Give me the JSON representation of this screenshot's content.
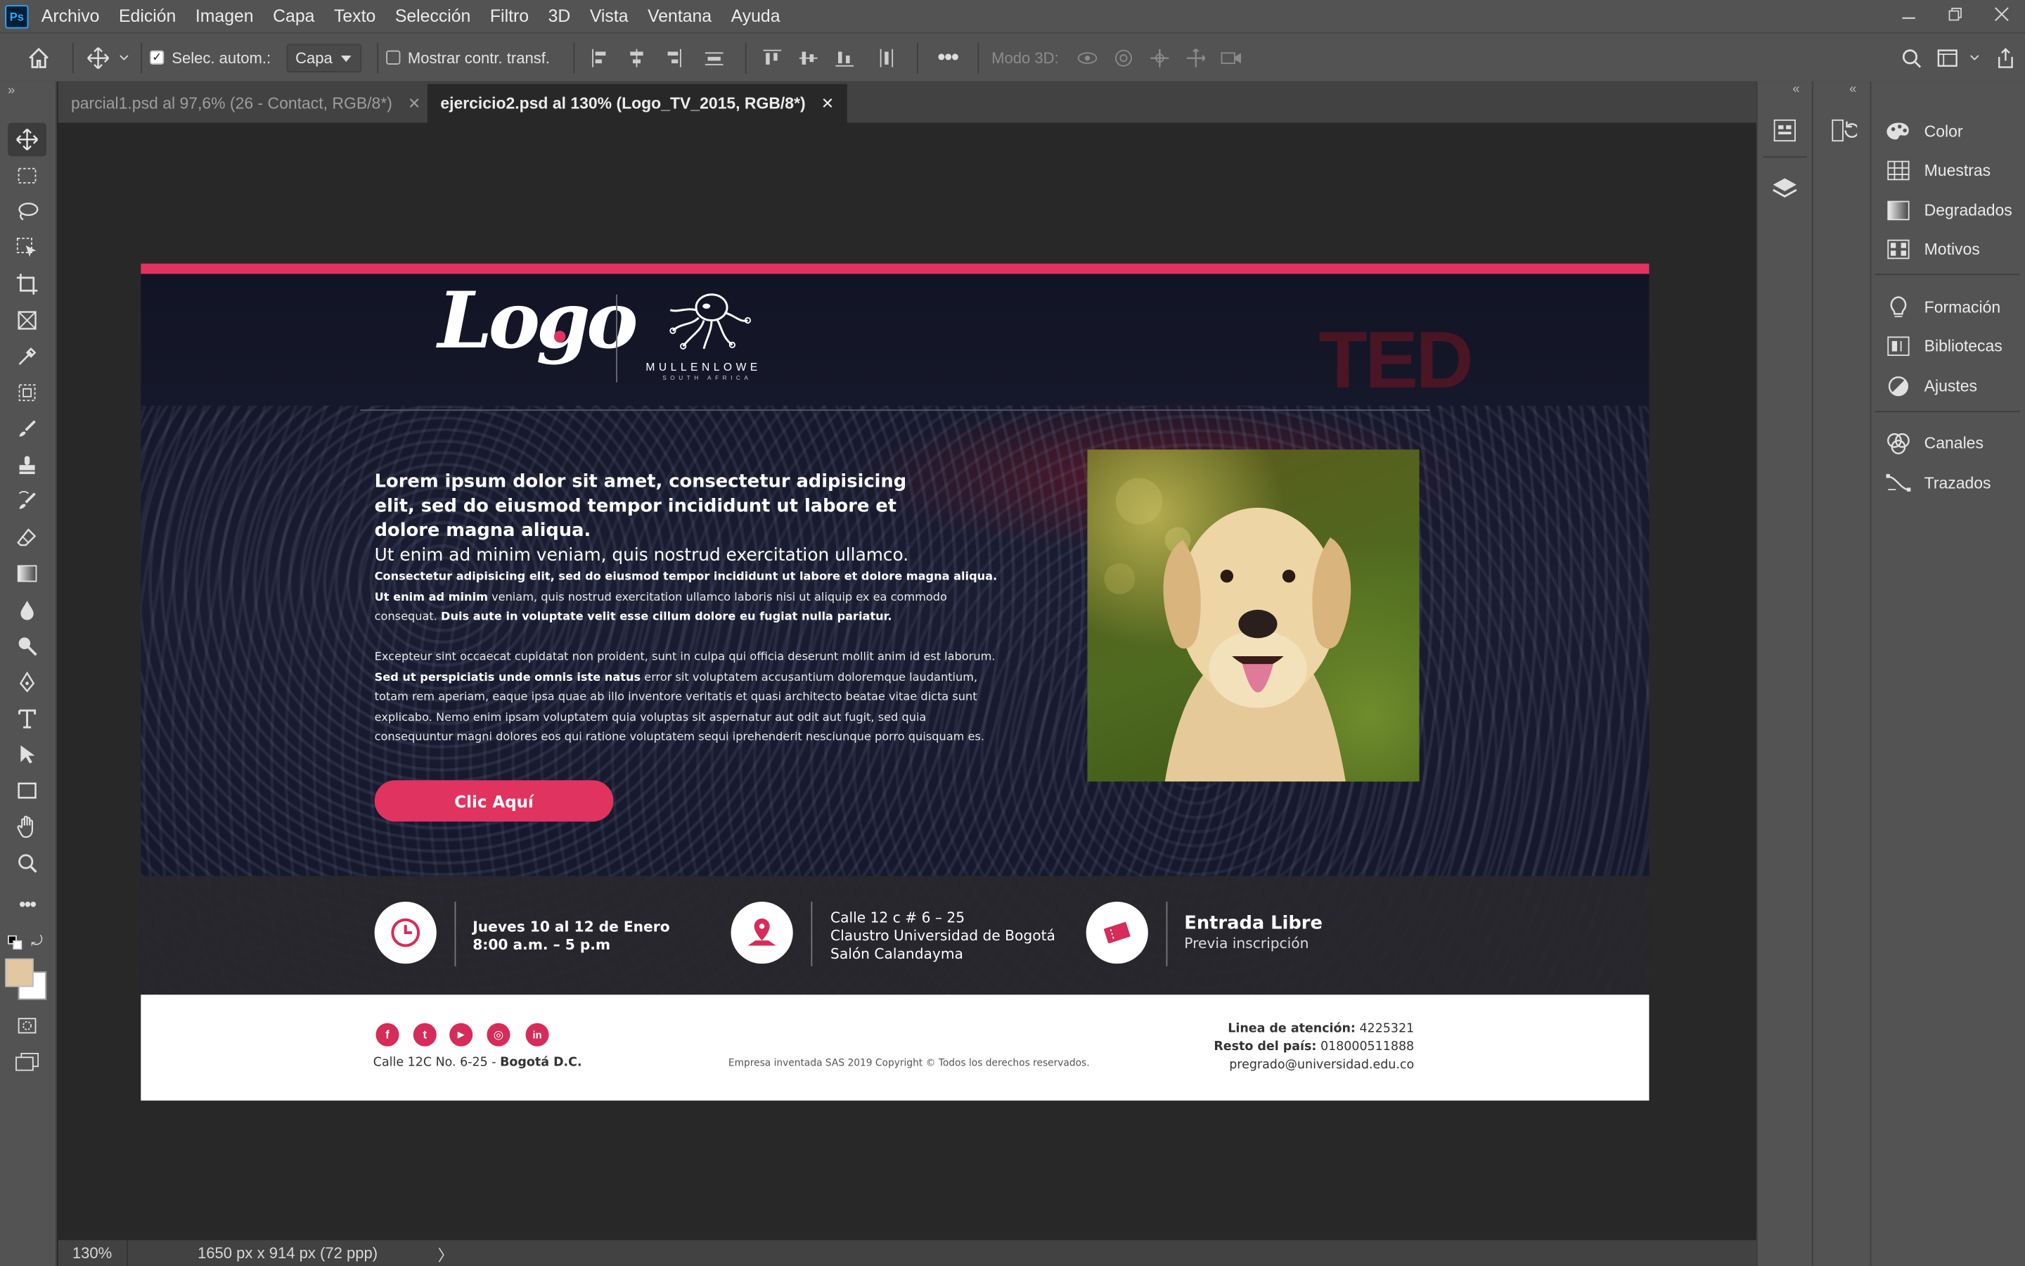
{
  "app": {
    "logo_text": "Ps"
  },
  "menu": [
    "Archivo",
    "Edición",
    "Imagen",
    "Capa",
    "Texto",
    "Selección",
    "Filtro",
    "3D",
    "Vista",
    "Ventana",
    "Ayuda"
  ],
  "options": {
    "auto_select_label": "Selec. autom.:",
    "auto_select_checked": true,
    "target_value": "Capa",
    "show_transform_label": "Mostrar contr. transf.",
    "show_transform_checked": false,
    "mode3d_label": "Modo 3D:"
  },
  "tabs": [
    {
      "label": "parcial1.psd al 97,6% (26 - Contact, RGB/8*)",
      "active": false
    },
    {
      "label": "ejercicio2.psd al 130% (Logo_TV_2015, RGB/8*)",
      "active": true
    }
  ],
  "status": {
    "zoom": "130%",
    "doc_info": "1650 px x 914 px (72 ppp)",
    "arrow": "〉"
  },
  "colors": {
    "accent": "#e0335f",
    "foreground_swatch": "#e3c7a3",
    "background_swatch": "#ffffff"
  },
  "panels": {
    "group1": [
      "Color",
      "Muestras",
      "Degradados",
      "Motivos"
    ],
    "group2": [
      "Formación",
      "Bibliotecas",
      "Ajustes"
    ],
    "group3": [
      "Canales",
      "Trazados"
    ]
  },
  "design": {
    "logo_text": "Logo",
    "partner_name": "MULLENLOWE",
    "partner_sub": "SOUTH AFRICA",
    "bg_watermark": "TED",
    "headline_bold": "Lorem ipsum dolor sit amet, consectetur adipisicing elit, sed do eiusmod tempor incididunt ut labore et dolore magna aliqua.",
    "headline_light": "Ut enim ad minim veniam, quis nostrud exercitation ullamco.",
    "p1_b1": "Consectetur adipisicing elit, sed do eiusmod tempor incididunt ut labore et dolore magna aliqua. Ut enim ad minim",
    "p1_t1": " veniam, quis nostrud exercitation ullamco laboris nisi ut aliquip ex ea commodo consequat. ",
    "p1_b2": "Duis aute in voluptate velit esse cillum dolore eu fugiat nulla pariatur.",
    "p2_t1": "Excepteur sint occaecat cupidatat non proident, sunt in culpa qui officia deserunt mollit anim id est laborum. ",
    "p2_b1": "Sed ut perspiciatis unde omnis iste natus",
    "p2_t2": " error sit voluptatem accusantium doloremque laudantium, totam rem aperiam, eaque ipsa quae ab illo inventore veritatis et quasi architecto beatae vitae dicta sunt explicabo. Nemo enim ipsam voluptatem quia voluptas sit aspernatur aut odit aut fugit, sed quia consequuntur magni dolores eos qui ratione voluptatem sequi iprehenderit  nesciunque porro quisquam es.",
    "cta_label": "Clic Aquí",
    "info1_line1": "Jueves 10 al 12 de Enero",
    "info1_line2": "8:00 a.m. – 5 p.m",
    "info2_line1": "Calle 12 c # 6 – 25",
    "info2_line2": "Claustro Universidad de Bogotá",
    "info2_line3": "Salón Calandayma",
    "info3_line1": "Entrada Libre",
    "info3_line2": "Previa inscripción",
    "social": [
      "f",
      "t",
      "▶",
      "◎",
      "in"
    ],
    "address_plain": "Calle 12C No. 6-25 - ",
    "address_city": "Bogotá D.C.",
    "copyright": "Empresa inventada SAS 2019 Copyright © Todos los derechos reservados.",
    "contact_label1": "Linea de atención:",
    "contact_value1": " 4225321",
    "contact_label2": "Resto del país:",
    "contact_value2": " 018000511888",
    "contact_email": "pregrado@universidad.edu.co"
  }
}
